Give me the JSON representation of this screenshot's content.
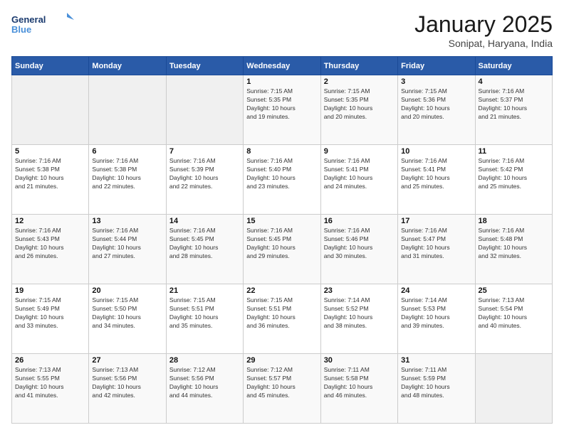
{
  "logo": {
    "line1": "General",
    "line2": "Blue"
  },
  "title": "January 2025",
  "location": "Sonipat, Haryana, India",
  "weekdays": [
    "Sunday",
    "Monday",
    "Tuesday",
    "Wednesday",
    "Thursday",
    "Friday",
    "Saturday"
  ],
  "weeks": [
    [
      {
        "day": "",
        "info": ""
      },
      {
        "day": "",
        "info": ""
      },
      {
        "day": "",
        "info": ""
      },
      {
        "day": "1",
        "info": "Sunrise: 7:15 AM\nSunset: 5:35 PM\nDaylight: 10 hours\nand 19 minutes."
      },
      {
        "day": "2",
        "info": "Sunrise: 7:15 AM\nSunset: 5:35 PM\nDaylight: 10 hours\nand 20 minutes."
      },
      {
        "day": "3",
        "info": "Sunrise: 7:15 AM\nSunset: 5:36 PM\nDaylight: 10 hours\nand 20 minutes."
      },
      {
        "day": "4",
        "info": "Sunrise: 7:16 AM\nSunset: 5:37 PM\nDaylight: 10 hours\nand 21 minutes."
      }
    ],
    [
      {
        "day": "5",
        "info": "Sunrise: 7:16 AM\nSunset: 5:38 PM\nDaylight: 10 hours\nand 21 minutes."
      },
      {
        "day": "6",
        "info": "Sunrise: 7:16 AM\nSunset: 5:38 PM\nDaylight: 10 hours\nand 22 minutes."
      },
      {
        "day": "7",
        "info": "Sunrise: 7:16 AM\nSunset: 5:39 PM\nDaylight: 10 hours\nand 22 minutes."
      },
      {
        "day": "8",
        "info": "Sunrise: 7:16 AM\nSunset: 5:40 PM\nDaylight: 10 hours\nand 23 minutes."
      },
      {
        "day": "9",
        "info": "Sunrise: 7:16 AM\nSunset: 5:41 PM\nDaylight: 10 hours\nand 24 minutes."
      },
      {
        "day": "10",
        "info": "Sunrise: 7:16 AM\nSunset: 5:41 PM\nDaylight: 10 hours\nand 25 minutes."
      },
      {
        "day": "11",
        "info": "Sunrise: 7:16 AM\nSunset: 5:42 PM\nDaylight: 10 hours\nand 25 minutes."
      }
    ],
    [
      {
        "day": "12",
        "info": "Sunrise: 7:16 AM\nSunset: 5:43 PM\nDaylight: 10 hours\nand 26 minutes."
      },
      {
        "day": "13",
        "info": "Sunrise: 7:16 AM\nSunset: 5:44 PM\nDaylight: 10 hours\nand 27 minutes."
      },
      {
        "day": "14",
        "info": "Sunrise: 7:16 AM\nSunset: 5:45 PM\nDaylight: 10 hours\nand 28 minutes."
      },
      {
        "day": "15",
        "info": "Sunrise: 7:16 AM\nSunset: 5:45 PM\nDaylight: 10 hours\nand 29 minutes."
      },
      {
        "day": "16",
        "info": "Sunrise: 7:16 AM\nSunset: 5:46 PM\nDaylight: 10 hours\nand 30 minutes."
      },
      {
        "day": "17",
        "info": "Sunrise: 7:16 AM\nSunset: 5:47 PM\nDaylight: 10 hours\nand 31 minutes."
      },
      {
        "day": "18",
        "info": "Sunrise: 7:16 AM\nSunset: 5:48 PM\nDaylight: 10 hours\nand 32 minutes."
      }
    ],
    [
      {
        "day": "19",
        "info": "Sunrise: 7:15 AM\nSunset: 5:49 PM\nDaylight: 10 hours\nand 33 minutes."
      },
      {
        "day": "20",
        "info": "Sunrise: 7:15 AM\nSunset: 5:50 PM\nDaylight: 10 hours\nand 34 minutes."
      },
      {
        "day": "21",
        "info": "Sunrise: 7:15 AM\nSunset: 5:51 PM\nDaylight: 10 hours\nand 35 minutes."
      },
      {
        "day": "22",
        "info": "Sunrise: 7:15 AM\nSunset: 5:51 PM\nDaylight: 10 hours\nand 36 minutes."
      },
      {
        "day": "23",
        "info": "Sunrise: 7:14 AM\nSunset: 5:52 PM\nDaylight: 10 hours\nand 38 minutes."
      },
      {
        "day": "24",
        "info": "Sunrise: 7:14 AM\nSunset: 5:53 PM\nDaylight: 10 hours\nand 39 minutes."
      },
      {
        "day": "25",
        "info": "Sunrise: 7:13 AM\nSunset: 5:54 PM\nDaylight: 10 hours\nand 40 minutes."
      }
    ],
    [
      {
        "day": "26",
        "info": "Sunrise: 7:13 AM\nSunset: 5:55 PM\nDaylight: 10 hours\nand 41 minutes."
      },
      {
        "day": "27",
        "info": "Sunrise: 7:13 AM\nSunset: 5:56 PM\nDaylight: 10 hours\nand 42 minutes."
      },
      {
        "day": "28",
        "info": "Sunrise: 7:12 AM\nSunset: 5:56 PM\nDaylight: 10 hours\nand 44 minutes."
      },
      {
        "day": "29",
        "info": "Sunrise: 7:12 AM\nSunset: 5:57 PM\nDaylight: 10 hours\nand 45 minutes."
      },
      {
        "day": "30",
        "info": "Sunrise: 7:11 AM\nSunset: 5:58 PM\nDaylight: 10 hours\nand 46 minutes."
      },
      {
        "day": "31",
        "info": "Sunrise: 7:11 AM\nSunset: 5:59 PM\nDaylight: 10 hours\nand 48 minutes."
      },
      {
        "day": "",
        "info": ""
      }
    ]
  ]
}
